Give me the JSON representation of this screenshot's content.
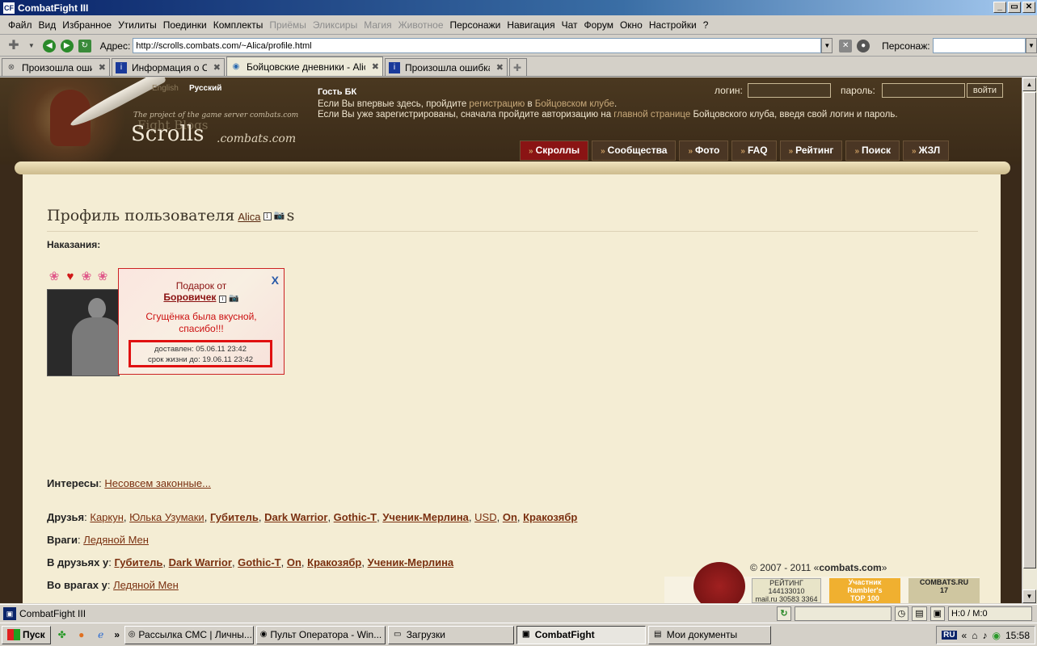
{
  "window": {
    "title": "CombatFight III",
    "app_icon": "CF",
    "controls": [
      "_",
      "▭",
      "✕"
    ]
  },
  "menu": [
    {
      "label": "Файл",
      "disabled": false
    },
    {
      "label": "Вид",
      "disabled": false
    },
    {
      "label": "Избранное",
      "disabled": false
    },
    {
      "label": "Утилиты",
      "disabled": false
    },
    {
      "label": "Поединки",
      "disabled": false
    },
    {
      "label": "Комплекты",
      "disabled": false
    },
    {
      "label": "Приёмы",
      "disabled": true
    },
    {
      "label": "Эликсиры",
      "disabled": true
    },
    {
      "label": "Магия",
      "disabled": true
    },
    {
      "label": "Животное",
      "disabled": true
    },
    {
      "label": "Персонажи",
      "disabled": false
    },
    {
      "label": "Навигация",
      "disabled": false
    },
    {
      "label": "Чат",
      "disabled": false
    },
    {
      "label": "Форум",
      "disabled": false
    },
    {
      "label": "Окно",
      "disabled": false
    },
    {
      "label": "Настройки",
      "disabled": false
    },
    {
      "label": "?",
      "disabled": false
    }
  ],
  "address": {
    "label": "Адрес:",
    "url": "http://scrolls.combats.com/~Alica/profile.html",
    "persona_label": "Персонаж:",
    "persona_value": ""
  },
  "tabs": [
    {
      "label": "Произошла ошибка",
      "icon": "error-page-icon",
      "active": false
    },
    {
      "label": "Информация о On",
      "icon": "info-page-icon",
      "active": false
    },
    {
      "label": "Бойцовские дневники - Alica",
      "icon": "globe-page-icon",
      "active": true
    },
    {
      "label": "Произошла ошибка",
      "icon": "info-page-icon",
      "active": false
    }
  ],
  "site": {
    "lang_en": "English",
    "lang_ru": "Русский",
    "tagline": "The project of the game server combats.com",
    "brand_sub": "Fight Blogs",
    "brand": "Scrolls",
    "brand_domain": ".combats.com",
    "guest_title": "Гость БК",
    "guest_line1_a": "Если Вы впервые здесь, пройдите ",
    "guest_line1_link1": "регистрацию",
    "guest_line1_b": " в ",
    "guest_line1_link2": "Бойцовском клубе",
    "guest_line1_c": ".",
    "guest_line2_a": "Если Вы уже зарегистрированы, сначала пройдите авторизацию на ",
    "guest_line2_link": "главной странице",
    "guest_line2_b": " Бойцовского клуба, введя свой логин и пароль.",
    "login_label": "логин:",
    "password_label": "пароль:",
    "login_button": "войти",
    "nav": [
      {
        "label": "Скроллы",
        "active": true
      },
      {
        "label": "Сообщества",
        "active": false
      },
      {
        "label": "Фото",
        "active": false
      },
      {
        "label": "FAQ",
        "active": false
      },
      {
        "label": "Рейтинг",
        "active": false
      },
      {
        "label": "Поиск",
        "active": false
      },
      {
        "label": "ЖЗЛ",
        "active": false
      }
    ]
  },
  "profile": {
    "title": "Профиль пользователя",
    "username": "Alica",
    "suffix": "s",
    "punish_label": "Наказания:",
    "gift": {
      "from_label": "Подарок от",
      "from_user": "Боровичек",
      "message_line1": "Сгущёнка была вкусной,",
      "message_line2": "спасибо!!!",
      "delivered": "доставлен: 05.06.11 23:42",
      "expires": "срок жизни до: 19.06.11 23:42",
      "close": "X"
    },
    "interests_label": "Интересы",
    "interests": "Несовсем законные...",
    "friends_label": "Друзья",
    "friends": [
      {
        "name": "Каркун",
        "bold": false
      },
      {
        "name": "Юлька Узумаки",
        "bold": false
      },
      {
        "name": "Губитель",
        "bold": true
      },
      {
        "name": "Dark Warrior",
        "bold": true
      },
      {
        "name": "Gothic-T",
        "bold": true
      },
      {
        "name": "Ученик-Мерлина",
        "bold": true
      },
      {
        "name": "USD",
        "bold": false
      },
      {
        "name": "On",
        "bold": true
      },
      {
        "name": "Кракозябр",
        "bold": true
      }
    ],
    "enemies_label": "Враги",
    "enemies": [
      {
        "name": "Ледяной Мен",
        "bold": false
      }
    ],
    "friend_of_label": "В друзьях у",
    "friend_of": [
      {
        "name": "Губитель",
        "bold": true
      },
      {
        "name": "Dark Warrior",
        "bold": true
      },
      {
        "name": "Gothic-T",
        "bold": true
      },
      {
        "name": "On",
        "bold": true
      },
      {
        "name": "Кракозябр",
        "bold": true
      },
      {
        "name": "Ученик-Мерлина",
        "bold": true
      }
    ],
    "enemy_of_label": "Во врагах у",
    "enemy_of": [
      {
        "name": "Ледяной Мен",
        "bold": false
      }
    ]
  },
  "footer": {
    "copyright_a": "© 2007 - 2011 «",
    "copyright_b": "combats.com",
    "copyright_c": "»",
    "badge1_a": "РЕЙТИНГ 144133010",
    "badge1_b": "mail.ru 30583 3364",
    "badge2_a": "Участник",
    "badge2_b": "Rambler's",
    "badge2_c": "TOP 100",
    "badge3_a": "COMBATS.RU",
    "badge3_b": "17"
  },
  "status": {
    "text": "CombatFight III",
    "hm": "H:0 / M:0"
  },
  "taskbar": {
    "start": "Пуск",
    "more": "»",
    "tasks": [
      {
        "label": "Рассылка СМС | Личны...",
        "active": false
      },
      {
        "label": "Пульт Оператора - Win...",
        "active": false
      },
      {
        "label": "Загрузки",
        "active": false
      },
      {
        "label": "CombatFight",
        "active": true
      },
      {
        "label": "Мои документы",
        "active": false
      }
    ],
    "lang": "RU",
    "tray_more": "«",
    "clock": "15:58"
  }
}
